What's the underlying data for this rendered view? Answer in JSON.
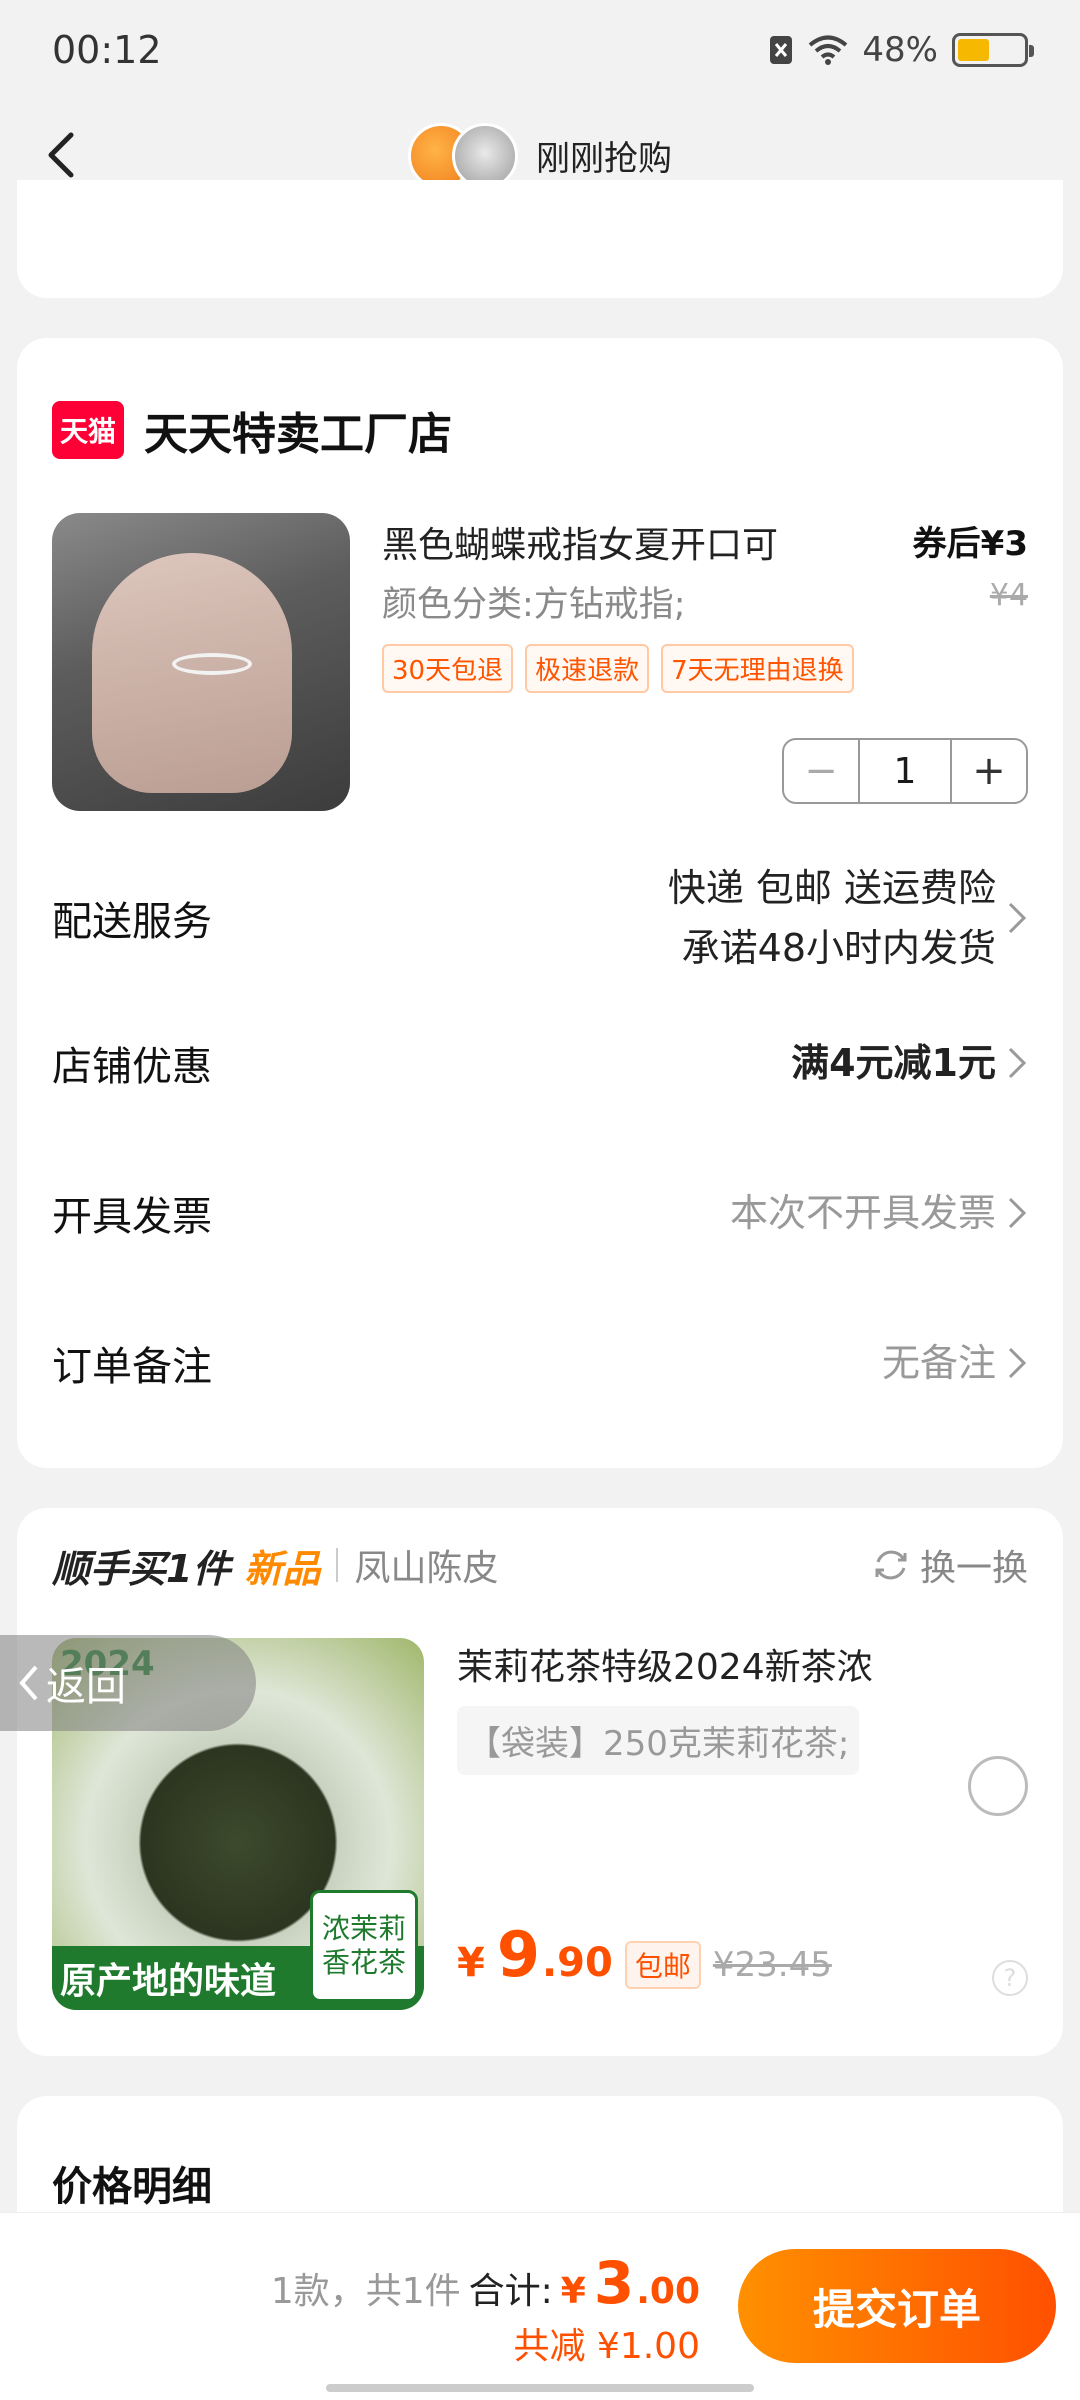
{
  "status_bar": {
    "time": "00:12",
    "battery": "48%",
    "battery_level": 0.48
  },
  "nav": {
    "title": "刚刚抢购"
  },
  "shop": {
    "name": "天天特卖工厂店",
    "logo_text": "天猫",
    "product": {
      "title": "黑色蝴蝶戒指女夏开口可",
      "price": "券后¥3",
      "original_price": "¥4",
      "variant": "颜色分类:方钻戒指;",
      "tags": [
        "30天包退",
        "极速退款",
        "7天无理由退换"
      ],
      "quantity": "1",
      "minus": "−",
      "plus": "+"
    },
    "delivery": {
      "label": "配送服务",
      "line1": "快递 包邮 送运费险",
      "line2": "承诺48小时内发货"
    },
    "coupon": {
      "label": "店铺优惠",
      "value": "满4元减1元"
    },
    "invoice": {
      "label": "开具发票",
      "value": "本次不开具发票"
    },
    "note": {
      "label": "订单备注",
      "value": "无备注"
    }
  },
  "recommend": {
    "title": "顺手买1件",
    "new_label": "新品",
    "brand": "凤山陈皮",
    "swap": "换一换",
    "image_text": {
      "year": "2024",
      "banner": "原产地的味道",
      "side": "浓茉莉香花茶"
    },
    "name": "茉莉花茶特级2024新茶浓",
    "variant": "【袋装】250克茉莉花茶;",
    "currency": "¥",
    "price_int": "9",
    "price_dec": ".90",
    "free_shipping": "包邮",
    "original_price": "¥23.45",
    "help": "?"
  },
  "return_button": {
    "label": "返回"
  },
  "price_detail": {
    "title": "价格明细"
  },
  "bottom": {
    "count": "1款，共1件",
    "total_label": "合计:",
    "currency": "¥",
    "total_int": "3",
    "total_dec": ".00",
    "discount": "共减 ¥1.00",
    "submit": "提交订单"
  }
}
